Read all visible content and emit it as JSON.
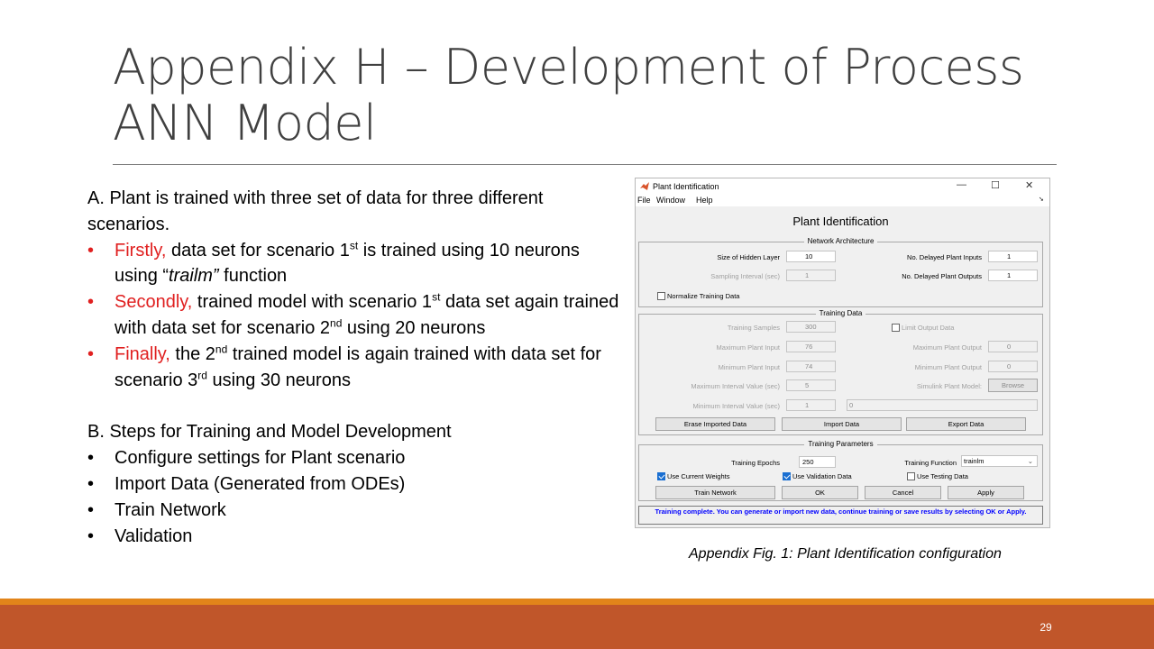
{
  "slide": {
    "title_line1": "Appendix H – Development of Process",
    "title_line2": "ANN Model",
    "page_number": "29",
    "caption": "Appendix Fig. 1: Plant Identification configuration",
    "colors": {
      "title": "#404040",
      "accent_red": "#e02020",
      "footer_orange": "#e2841a",
      "footer_rust": "#c0562a"
    }
  },
  "section_a": {
    "intro": "A. Plant is trained with three set of data for three different scenarios.",
    "bullets": [
      {
        "lead": "Firstly,",
        "t1": " data set for scenario 1",
        "sup1": "st",
        "t2": "  is trained using 10 neurons using “",
        "em": "trailm”",
        "t3": " function"
      },
      {
        "lead": "Secondly,",
        "t1": " trained model with scenario 1",
        "sup1": "st",
        "t2": " data set again trained with data set for scenario 2",
        "sup2": "nd",
        "t3": " using 20 neurons"
      },
      {
        "lead": "Finally,",
        "t1": " the 2",
        "sup1": "nd",
        "t2": " trained model  is again trained with data set for scenario 3",
        "sup2": "rd",
        "t3": " using 30 neurons"
      }
    ]
  },
  "section_b": {
    "heading": "B. Steps for Training and Model Development",
    "bullet_symbol": "•",
    "items": [
      "Configure settings for Plant scenario",
      "Import Data (Generated from ODEs)",
      "Train Network",
      "Validation"
    ]
  },
  "window": {
    "title": "Plant Identification",
    "menu": [
      "File",
      "Window",
      "Help"
    ],
    "heading": "Plant Identification",
    "network_architecture": {
      "label": "Network Architecture",
      "hidden_layer_label": "Size of Hidden Layer",
      "hidden_layer_value": "10",
      "sampling_label": "Sampling Interval (sec)",
      "sampling_value": "1",
      "delayed_inputs_label": "No. Delayed Plant Inputs",
      "delayed_inputs_value": "1",
      "delayed_outputs_label": "No. Delayed Plant Outputs",
      "delayed_outputs_value": "1",
      "normalize_label": "Normalize Training Data"
    },
    "training_data": {
      "label": "Training Data",
      "samples_label": "Training Samples",
      "samples_value": "300",
      "max_input_label": "Maximum Plant Input",
      "max_input_value": "76",
      "min_input_label": "Minimum Plant Input",
      "min_input_value": "74",
      "max_interval_label": "Maximum Interval Value (sec)",
      "max_interval_value": "5",
      "min_interval_label": "Minimum Interval Value (sec)",
      "min_interval_value": "1",
      "limit_output_label": "Limit Output Data",
      "max_output_label": "Maximum Plant Output",
      "max_output_value": "0",
      "min_output_label": "Minimum Plant Output",
      "min_output_value": "0",
      "simulink_label": "Simulink Plant Model:",
      "browse_label": "Browse",
      "path_value": "0",
      "erase_label": "Erase Imported Data",
      "import_label": "Import Data",
      "export_label": "Export Data"
    },
    "training_parameters": {
      "label": "Training Parameters",
      "epochs_label": "Training Epochs",
      "epochs_value": "250",
      "function_label": "Training Function",
      "function_value": "trainlm",
      "use_weights_label": "Use Current Weights",
      "use_validation_label": "Use Validation Data",
      "use_testing_label": "Use Testing Data"
    },
    "buttons": {
      "train": "Train Network",
      "ok": "OK",
      "cancel": "Cancel",
      "apply": "Apply"
    },
    "status": "Training complete. You can generate or import new data, continue training or save results by selecting OK or Apply."
  }
}
